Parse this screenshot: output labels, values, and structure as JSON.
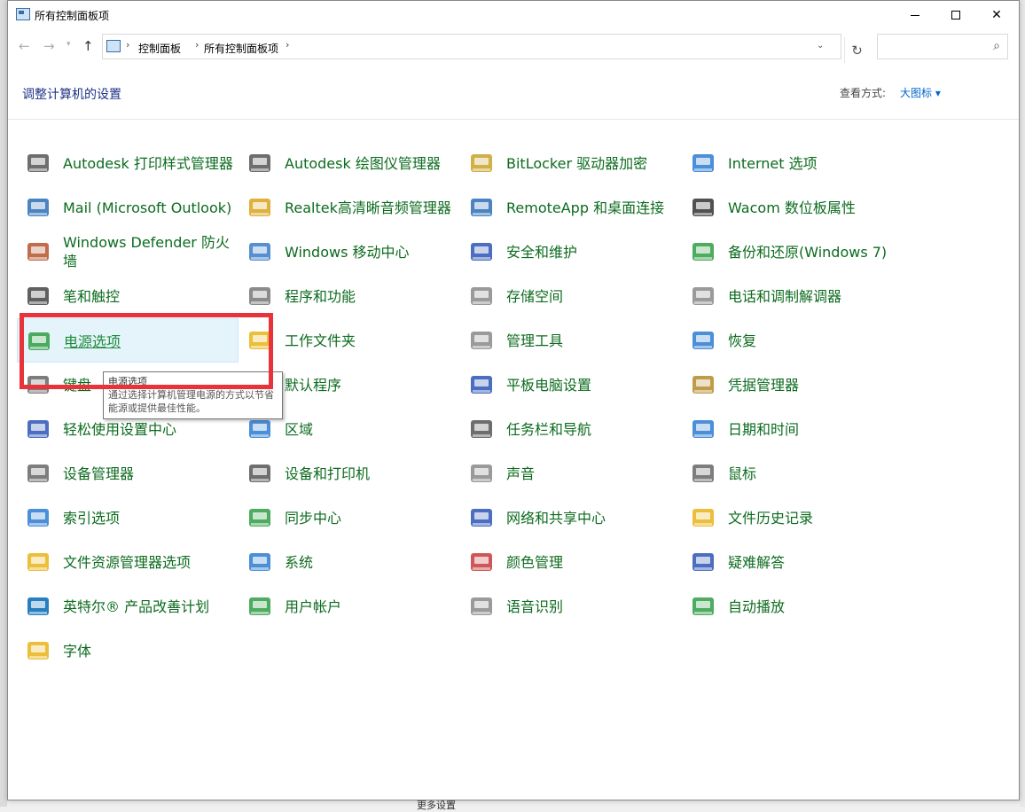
{
  "window": {
    "title": "所有控制面板项"
  },
  "nav": {
    "breadcrumb": [
      "控制面板",
      "所有控制面板项"
    ],
    "search_placeholder": ""
  },
  "header": {
    "title": "调整计算机的设置",
    "view_label": "查看方式:",
    "view_value": "大图标 ▾"
  },
  "items": [
    {
      "label": "Autodesk 打印样式管理器",
      "icon": "printer-icon",
      "color": "#555555"
    },
    {
      "label": "Autodesk 绘图仪管理器",
      "icon": "plotter-icon",
      "color": "#555555"
    },
    {
      "label": "BitLocker 驱动器加密",
      "icon": "bitlocker-icon",
      "color": "#c9a227"
    },
    {
      "label": "Internet 选项",
      "icon": "internet-icon",
      "color": "#2b7bd1"
    },
    {
      "label": "Mail (Microsoft Outlook)",
      "icon": "mail-icon",
      "color": "#2b6fb5"
    },
    {
      "label": "Realtek高清晰音频管理器",
      "icon": "audio-manager-icon",
      "color": "#d9a21b"
    },
    {
      "label": "RemoteApp 和桌面连接",
      "icon": "remoteapp-icon",
      "color": "#2b6fb5"
    },
    {
      "label": "Wacom 数位板属性",
      "icon": "tablet-icon",
      "color": "#333333"
    },
    {
      "label": "Windows Defender 防火墙",
      "icon": "firewall-icon",
      "color": "#b5542b"
    },
    {
      "label": "Windows 移动中心",
      "icon": "mobility-center-icon",
      "color": "#3a7bc8"
    },
    {
      "label": "安全和维护",
      "icon": "flag-icon",
      "color": "#2b55b5"
    },
    {
      "label": "备份和还原(Windows 7)",
      "icon": "backup-icon",
      "color": "#2f9e44"
    },
    {
      "label": "笔和触控",
      "icon": "pen-icon",
      "color": "#444444"
    },
    {
      "label": "程序和功能",
      "icon": "programs-icon",
      "color": "#777777"
    },
    {
      "label": "存储空间",
      "icon": "storage-icon",
      "color": "#888888"
    },
    {
      "label": "电话和调制解调器",
      "icon": "phone-icon",
      "color": "#888888"
    },
    {
      "label": "电源选项",
      "icon": "power-icon",
      "color": "#2f9e44"
    },
    {
      "label": "工作文件夹",
      "icon": "work-folder-icon",
      "color": "#e7b416"
    },
    {
      "label": "管理工具",
      "icon": "admin-tools-icon",
      "color": "#888888"
    },
    {
      "label": "恢复",
      "icon": "recovery-icon",
      "color": "#2b7bd1"
    },
    {
      "label": "键盘",
      "icon": "keyboard-icon",
      "color": "#666666"
    },
    {
      "label": "默认程序",
      "icon": "default-programs-icon",
      "color": "#2b7bd1"
    },
    {
      "label": "平板电脑设置",
      "icon": "tablet-pc-icon",
      "color": "#2b55b5"
    },
    {
      "label": "凭据管理器",
      "icon": "credential-icon",
      "color": "#b58a2b"
    },
    {
      "label": "轻松使用设置中心",
      "icon": "ease-of-access-icon",
      "color": "#2b55b5"
    },
    {
      "label": "区域",
      "icon": "region-icon",
      "color": "#2b7bd1"
    },
    {
      "label": "任务栏和导航",
      "icon": "taskbar-icon",
      "color": "#555555"
    },
    {
      "label": "日期和时间",
      "icon": "datetime-icon",
      "color": "#2b7bd1"
    },
    {
      "label": "设备管理器",
      "icon": "device-manager-icon",
      "color": "#666666"
    },
    {
      "label": "设备和打印机",
      "icon": "devices-printers-icon",
      "color": "#555555"
    },
    {
      "label": "声音",
      "icon": "speaker-icon",
      "color": "#888888"
    },
    {
      "label": "鼠标",
      "icon": "mouse-icon",
      "color": "#666666"
    },
    {
      "label": "索引选项",
      "icon": "indexing-icon",
      "color": "#2b7bd1"
    },
    {
      "label": "同步中心",
      "icon": "sync-icon",
      "color": "#2f9e44"
    },
    {
      "label": "网络和共享中心",
      "icon": "network-icon",
      "color": "#2b55b5"
    },
    {
      "label": "文件历史记录",
      "icon": "file-history-icon",
      "color": "#e7b416"
    },
    {
      "label": "文件资源管理器选项",
      "icon": "folder-options-icon",
      "color": "#e7b416"
    },
    {
      "label": "系统",
      "icon": "system-icon",
      "color": "#2b7bd1"
    },
    {
      "label": "颜色管理",
      "icon": "color-management-icon",
      "color": "#c83a3a"
    },
    {
      "label": "疑难解答",
      "icon": "troubleshoot-icon",
      "color": "#2b55b5"
    },
    {
      "label": "英特尔® 产品改善计划",
      "icon": "intel-icon",
      "color": "#0068b5"
    },
    {
      "label": "用户帐户",
      "icon": "user-accounts-icon",
      "color": "#2f9e44"
    },
    {
      "label": "语音识别",
      "icon": "microphone-icon",
      "color": "#888888"
    },
    {
      "label": "自动播放",
      "icon": "autoplay-icon",
      "color": "#2f9e44"
    },
    {
      "label": "字体",
      "icon": "fonts-icon",
      "color": "#e7b416"
    }
  ],
  "tooltip": {
    "title": "电源选项",
    "desc": "通过选择计算机管理电源的方式以节省能源或提供最佳性能。"
  },
  "background": {
    "bottom_text": "更多设置"
  }
}
